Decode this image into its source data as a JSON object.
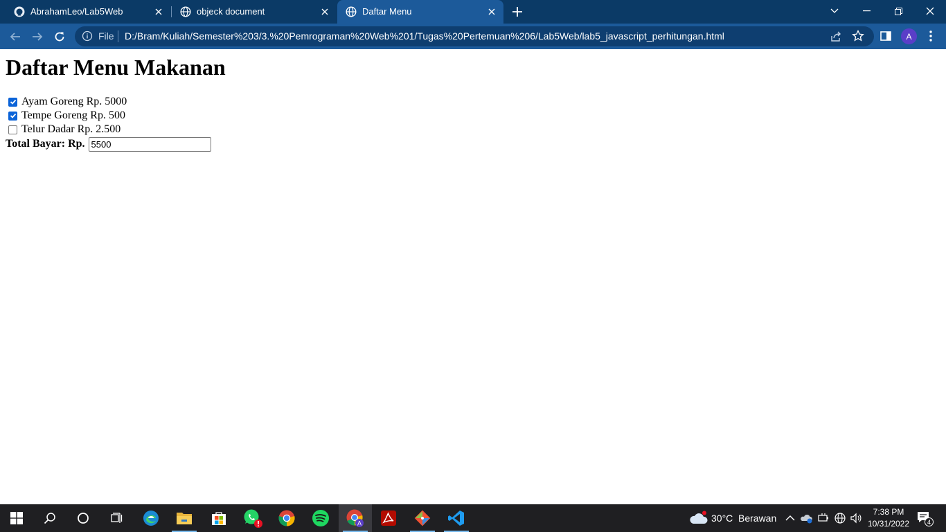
{
  "browser": {
    "tabs": [
      {
        "title": "AbrahamLeo/Lab5Web",
        "icon": "github-icon",
        "active": false
      },
      {
        "title": "objeck document",
        "icon": "globe-icon",
        "active": false
      },
      {
        "title": "Daftar Menu",
        "icon": "globe-icon",
        "active": true
      }
    ],
    "address": {
      "scheme_label": "File",
      "url": "D:/Bram/Kuliah/Semester%203/3.%20Pemrograman%20Web%201/Tugas%20Pertemuan%206/Lab5Web/lab5_javascript_perhitungan.html"
    },
    "profile_initial": "A",
    "colors": {
      "tabstrip": "#0b3a66",
      "toolbar": "#1c5a9a",
      "omnibox": "#0e3e70"
    }
  },
  "page": {
    "heading": "Daftar Menu Makanan",
    "menu_items": [
      {
        "label": "Ayam Goreng Rp. 5000",
        "checked": true
      },
      {
        "label": "Tempe Goreng Rp. 500",
        "checked": true
      },
      {
        "label": "Telur Dadar Rp. 2.500",
        "checked": false
      }
    ],
    "total_label": "Total Bayar: Rp.",
    "total_value": "5500"
  },
  "taskbar": {
    "apps": [
      "windows-start-icon",
      "search-icon",
      "cortana-icon",
      "task-view-icon",
      "edge-icon",
      "file-explorer-icon",
      "store-icon",
      "whatsapp-icon",
      "chrome-icon",
      "spotify-icon",
      "chrome-profile-icon",
      "acrobat-icon",
      "git-icon",
      "vscode-icon"
    ],
    "weather": {
      "temp": "30°C",
      "desc": "Berawan"
    },
    "clock": {
      "time": "7:38 PM",
      "date": "10/31/2022"
    },
    "notifications_count": "4"
  }
}
